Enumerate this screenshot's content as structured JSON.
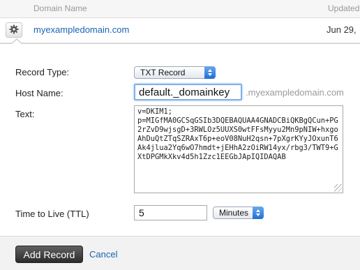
{
  "table_header": {
    "domain_name": "Domain Name",
    "updated": "Updated"
  },
  "domain_row": {
    "domain": "myexampledomain.com",
    "updated": "Jun 29,"
  },
  "form": {
    "record_type_label": "Record Type:",
    "record_type_value": "TXT Record",
    "host_name_label": "Host Name:",
    "host_name_value": "default._domainkey",
    "host_suffix": ".myexampledomain.com",
    "text_label": "Text:",
    "text_value": "v=DKIM1;\np=MIGfMA0GCSqGSIb3DQEBAQUAA4GNADCBiQKBgQCun+PG2rZvD9wjsgD+3RWLOz5UUXS0wtFFsMyyu2Mn9pNIW+hxgoAhDuQtZTqSZRAxT6p+eoV08NuH2qsn+7pXgrKYyJOxunT6Ak4jlua2Yq6wO7hmdt+jEHhA2zOiRW14yx/rbg3/TWT9+GXtDPGMkXkv4d5h1Zzc1EEGbJApIQIDAQAB",
    "ttl_label": "Time to Live (TTL)",
    "ttl_value": "5",
    "ttl_unit": "Minutes"
  },
  "actions": {
    "add_record": "Add Record",
    "cancel": "Cancel"
  },
  "colors": {
    "link": "#1b63b5",
    "focus": "#7fb0e8",
    "select_arrow": "#1f6fd6"
  },
  "icons": [
    "gear-icon",
    "chevron-up-down-icon",
    "resize-grip-icon"
  ]
}
